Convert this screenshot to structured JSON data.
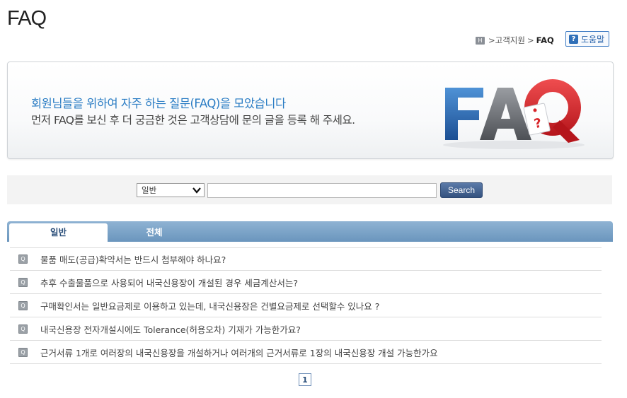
{
  "page": {
    "title": "FAQ"
  },
  "breadcrumb": {
    "home_icon": "home-icon",
    "section": ">고객지원",
    "separator": ">",
    "current": "FAQ"
  },
  "help": {
    "label": "도움말",
    "icon": "question-icon"
  },
  "banner": {
    "headline": "회원님들을 위하여 자주 하는 질문(FAQ)을 모았습니다",
    "description": "먼저 FAQ를 보신 후 더 궁금한 것은 고객상담에 문의 글을 등록 해 주세요.",
    "logo_text": "FAQ",
    "colors": {
      "headline": "#2a7cc4",
      "logo_f": "#2f6fb8",
      "logo_a": "#6d7075",
      "logo_q": "#d8262b"
    }
  },
  "search": {
    "category": "일반",
    "query": "",
    "button_label": "Search"
  },
  "tabs": [
    {
      "label": "일반",
      "active": true
    },
    {
      "label": "전체",
      "active": false
    }
  ],
  "faq_items": [
    "물품 매도(공급)확약서는 반드시 첨부해야 하나요?",
    "추후 수출물품으로 사용되어 내국신용장이 개설된 경우 세금계산서는?",
    "구매확인서는 일반요금제로 이용하고 있는데, 내국신용장은 건별요금제로 선택할수 있나요 ?",
    "내국신용장 전자개설시에도 Tolerance(허용오차) 기재가 가능한가요?",
    "근거서류 1개로 여러장의 내국신용장을 개설하거나 여러개의 근거서류로 1장의 내국신용장 개설 가능한가요"
  ],
  "pagination": {
    "current": "1"
  }
}
